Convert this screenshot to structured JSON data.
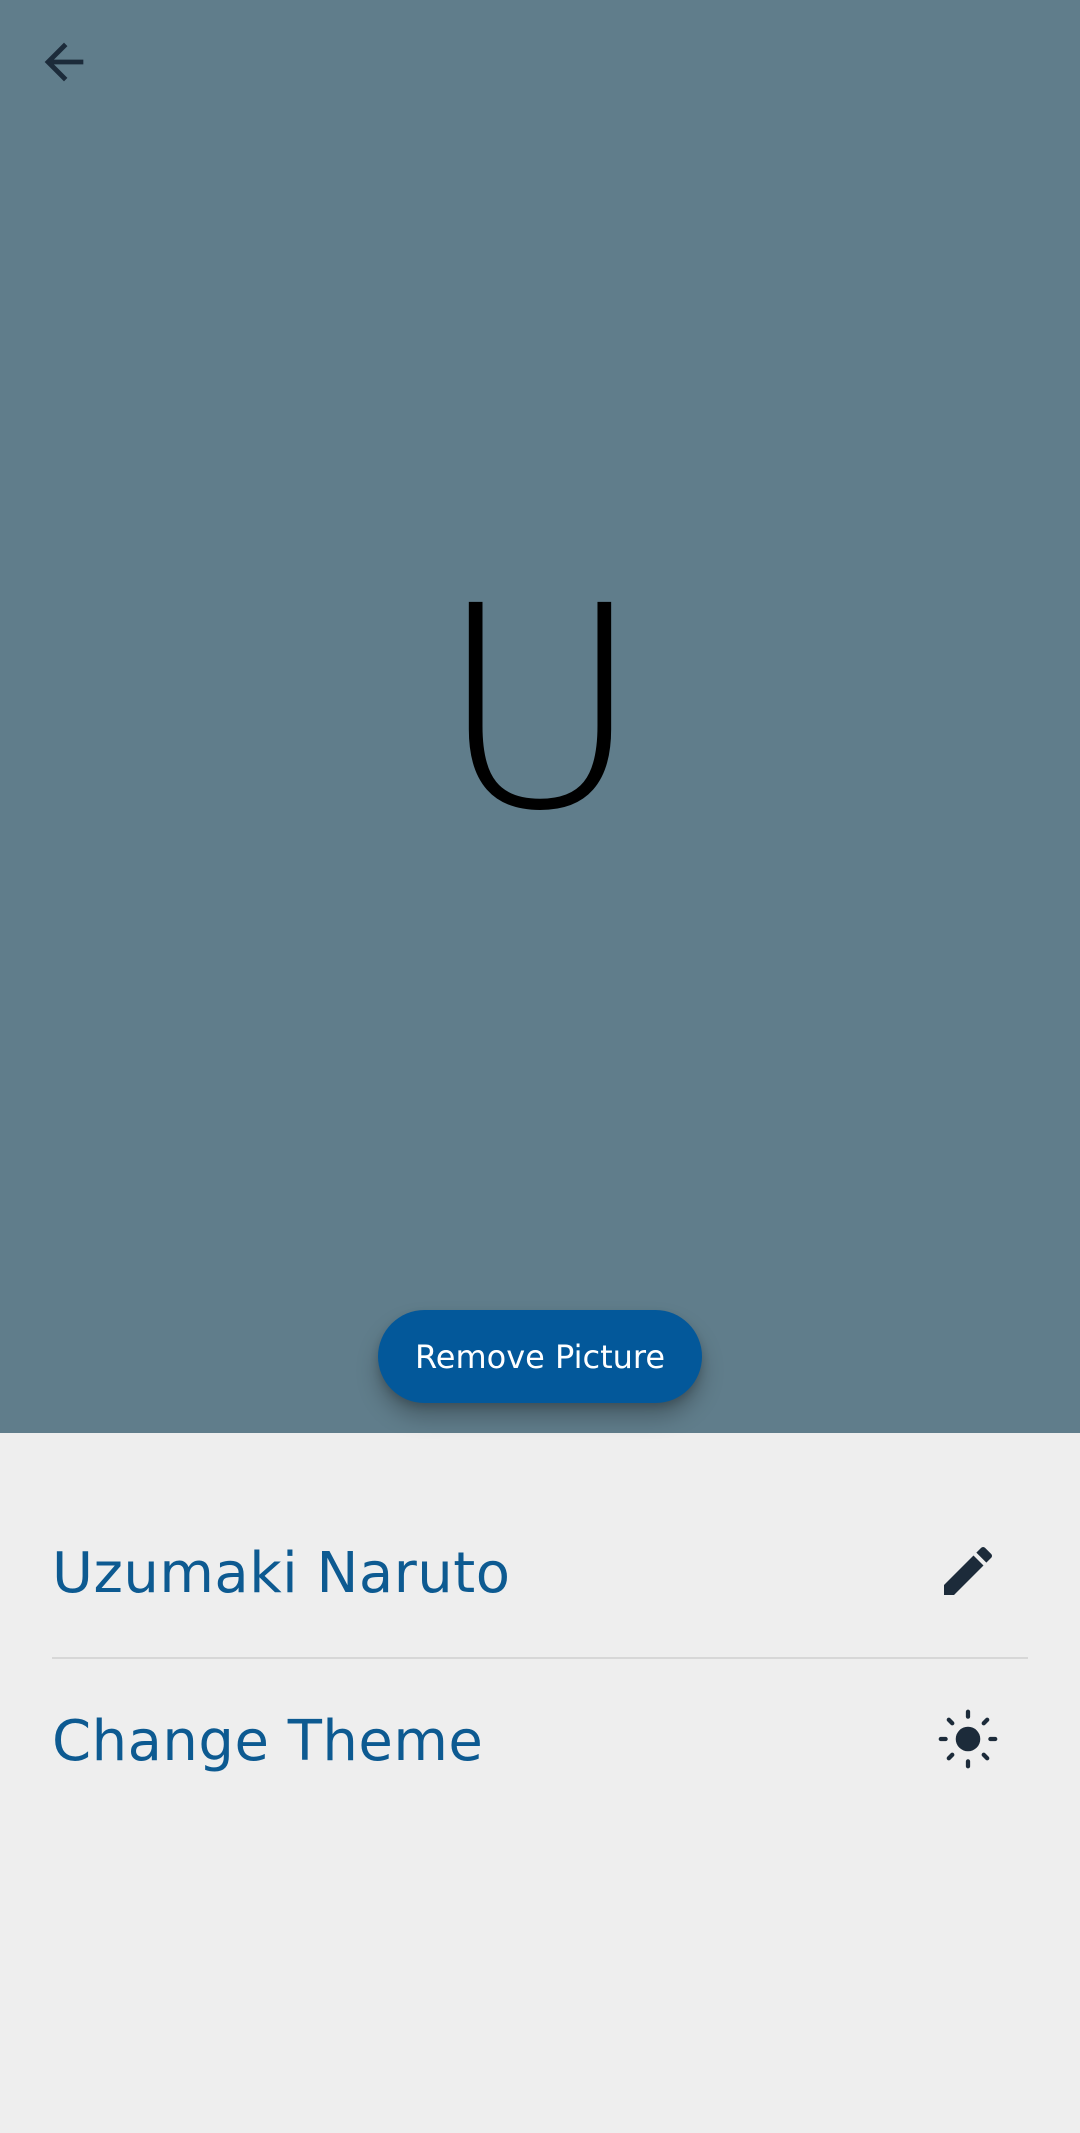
{
  "header": {
    "back_icon": "arrow-left-icon"
  },
  "avatar": {
    "initial": "U",
    "background_color": "#607d8b"
  },
  "remove_picture": {
    "label": "Remove Picture",
    "color": "#03589a"
  },
  "profile": {
    "name": "Uzumaki Naruto",
    "edit_icon": "pencil-icon"
  },
  "settings": {
    "theme_label": "Change Theme",
    "theme_icon": "sun-icon"
  },
  "colors": {
    "accent_text": "#0d5a91",
    "icon": "#1c2b3a",
    "surface": "#eeeeee"
  }
}
